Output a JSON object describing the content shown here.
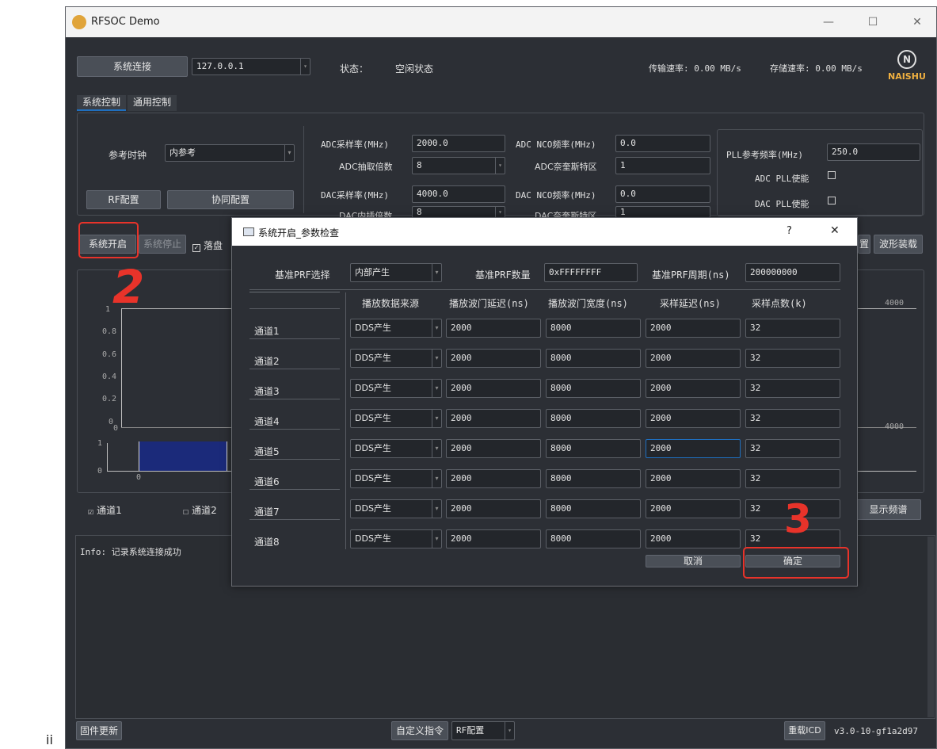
{
  "window": {
    "title": "RFSOC Demo",
    "logo_text": "NAISHU",
    "minimize": "—",
    "maximize": "☐",
    "close": "✕"
  },
  "toolbar": {
    "connect_label": "系统连接",
    "ip_value": "127.0.0.1",
    "status_label": "状态：",
    "status_value": "空闲状态",
    "transfer_rate": "传输速率: 0.00 MB/s",
    "storage_rate": "存储速率: 0.00 MB/s"
  },
  "tabs": [
    {
      "label": "系统控制"
    },
    {
      "label": "通用控制"
    }
  ],
  "config": {
    "ref_clock_label": "参考时钟",
    "ref_clock_value": "内参考",
    "rf_config": "RF配置",
    "sync_config": "协同配置",
    "adc_sample_rate_label": "ADC采样率(MHz)",
    "adc_sample_rate_value": "2000.0",
    "adc_decim_label": "ADC抽取倍数",
    "adc_decim_value": "8",
    "dac_sample_rate_label": "DAC采样率(MHz)",
    "dac_sample_rate_value": "4000.0",
    "dac_interp_label": "DAC内插倍数",
    "dac_interp_value": "8",
    "adc_nco_label": "ADC NCO频率(MHz)",
    "adc_nco_value": "0.0",
    "adc_nyq_label": "ADC奈奎斯特区",
    "adc_nyq_value": "1",
    "dac_nco_label": "DAC NCO频率(MHz)",
    "dac_nco_value": "0.0",
    "dac_nyq_label": "DAC奈奎斯特区",
    "dac_nyq_value": "1",
    "pll_ref_label": "PLL参考频率(MHz)",
    "pll_ref_value": "250.0",
    "adc_pll_label": "ADC PLL使能",
    "dac_pll_label": "DAC PLL使能"
  },
  "controls": {
    "start": "系统开启",
    "stop": "系统停止",
    "save": "落盘",
    "right_cut": "置",
    "waveform_load": "波形装载",
    "show_spectrum": "显示频谱"
  },
  "plot": {
    "yticks": [
      "1",
      "0.8",
      "0.6",
      "0.4",
      "0.2",
      "0"
    ],
    "x_left": "0",
    "x_right": "4000",
    "mini_y_top": "1",
    "mini_y_bottom": "0",
    "mini_x": "0"
  },
  "channels_check": [
    {
      "label": "通道1",
      "checked": "☑"
    },
    {
      "label": "通道2",
      "checked": "☐"
    }
  ],
  "log": {
    "text": "Info: 记录系统连接成功"
  },
  "statusbar": {
    "firmware": "固件更新",
    "custom_cmd": "自定义指令",
    "rf_select": "RF配置",
    "reload_icd": "重载ICD",
    "version": "v3.0-10-gf1a2d97"
  },
  "dialog": {
    "title": "系统开启_参数检查",
    "help": "?",
    "close": "✕",
    "prf_select_label": "基准PRF选择",
    "prf_select_value": "内部产生",
    "prf_count_label": "基准PRF数量",
    "prf_count_value": "0xFFFFFFFF",
    "prf_period_label": "基准PRF周期(ns)",
    "prf_period_value": "200000000",
    "columns": [
      "播放数据来源",
      "播放波门延迟(ns)",
      "播放波门宽度(ns)",
      "采样延迟(ns)",
      "采样点数(k)"
    ],
    "rows": [
      {
        "name": "通道1",
        "source": "DDS产生",
        "play_delay": "2000",
        "play_width": "8000",
        "sample_delay": "2000",
        "points": "32"
      },
      {
        "name": "通道2",
        "source": "DDS产生",
        "play_delay": "2000",
        "play_width": "8000",
        "sample_delay": "2000",
        "points": "32"
      },
      {
        "name": "通道3",
        "source": "DDS产生",
        "play_delay": "2000",
        "play_width": "8000",
        "sample_delay": "2000",
        "points": "32"
      },
      {
        "name": "通道4",
        "source": "DDS产生",
        "play_delay": "2000",
        "play_width": "8000",
        "sample_delay": "2000",
        "points": "32"
      },
      {
        "name": "通道5",
        "source": "DDS产生",
        "play_delay": "2000",
        "play_width": "8000",
        "sample_delay": "2000",
        "points": "32"
      },
      {
        "name": "通道6",
        "source": "DDS产生",
        "play_delay": "2000",
        "play_width": "8000",
        "sample_delay": "2000",
        "points": "32"
      },
      {
        "name": "通道7",
        "source": "DDS产生",
        "play_delay": "2000",
        "play_width": "8000",
        "sample_delay": "2000",
        "points": "32"
      },
      {
        "name": "通道8",
        "source": "DDS产生",
        "play_delay": "2000",
        "play_width": "8000",
        "sample_delay": "2000",
        "points": "32"
      }
    ],
    "cancel": "取消",
    "ok": "确定"
  },
  "annotations": {
    "mark2": "2",
    "mark3": "3",
    "footer_glyph": "ii"
  },
  "colors": {
    "background": "#2c2f35",
    "field": "#23262b",
    "accent_blue": "#1f6fbf",
    "annotation_red": "#e8332a",
    "plot_bar": "#1b2a7a"
  }
}
